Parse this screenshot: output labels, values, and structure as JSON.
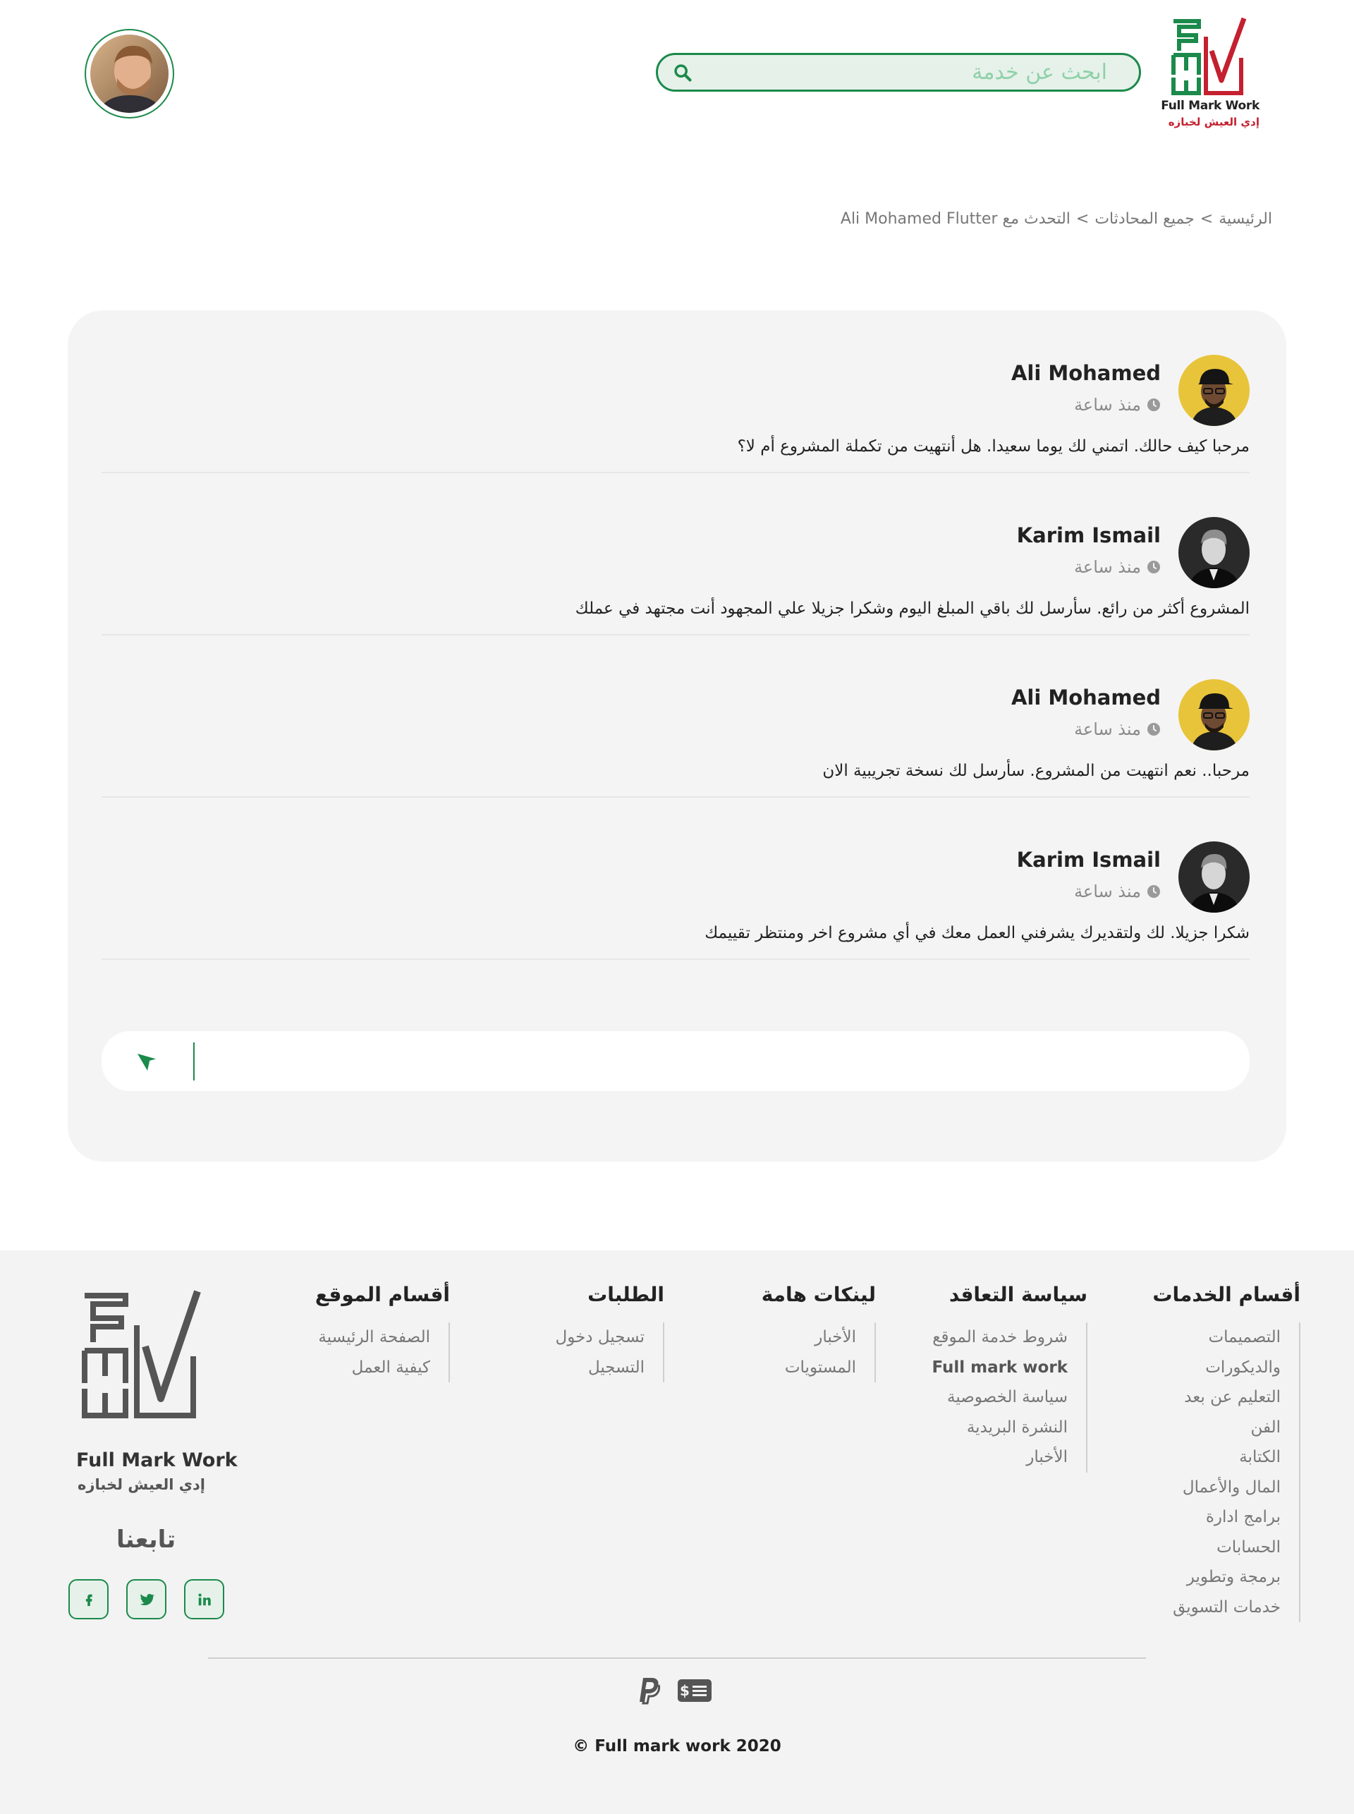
{
  "header": {
    "logo_text": "Full Mark Work",
    "logo_tagline": "إدي العيش لخبازه",
    "search_placeholder": "ابحث عن خدمة",
    "brand_green": "#1b8a4b",
    "brand_red": "#c4202f"
  },
  "breadcrumb": {
    "home": "الرئيسية",
    "sep1": ">",
    "all_chats": "جميع المحادثات",
    "sep2": ">",
    "current": "التحدث مع Ali Mohamed Flutter"
  },
  "messages": [
    {
      "name": "Ali Mohamed",
      "time": "منذ ساعة",
      "text": "مرحبا كيف حالك. اتمني لك يوما سعيدا. هل أنتهيت من تكملة المشروع أم لا؟",
      "avatar": "yellow-avatar"
    },
    {
      "name": "Karim Ismail",
      "time": "منذ ساعة",
      "text": "المشروع أكثر من رائع. سأرسل لك باقي المبلغ اليوم وشكرا جزيلا علي المجهود أنت مجتهد في عملك",
      "avatar": "bw-avatar"
    },
    {
      "name": "Ali Mohamed",
      "time": "منذ ساعة",
      "text": "مرحبا.. نعم انتهيت من المشروع. سأرسل لك نسخة تجريبية الان",
      "avatar": "yellow-avatar"
    },
    {
      "name": "Karim Ismail",
      "time": "منذ ساعة",
      "text": "شكرا جزيلا. لك ولتقديرك يشرفني العمل معك في أي مشروع اخر ومنتظر تقييمك",
      "avatar": "bw-avatar"
    }
  ],
  "composer": {
    "value": "",
    "send_icon": "send-icon"
  },
  "footer": {
    "columns": [
      {
        "title": "أقسام الخدمات",
        "items": [
          "التصميمات",
          "والديكورات",
          "التعليم عن بعد",
          "الفن",
          "الكتابة",
          "المال والأعمال",
          "برامج ادارة",
          "الحسابات",
          "برمجة وتطوير",
          "خدمات التسويق"
        ]
      },
      {
        "title": "سياسة التعاقد",
        "items": [
          "شروط خدمة الموقع",
          "Full mark work",
          "سياسة الخصوصية",
          "النشرة البريدية",
          "الأخبار"
        ]
      },
      {
        "title": "لينكات هامة",
        "items": [
          "الأخبار",
          "المستويات"
        ]
      },
      {
        "title": "الطلبات",
        "items": [
          "تسجيل دخول",
          "التسجيل"
        ]
      },
      {
        "title": "أقسام الموقع",
        "items": [
          "الصفحة الرئيسية",
          "كيفية العمل"
        ]
      }
    ],
    "logo_text": "Full Mark Work",
    "logo_tagline": "إدي العيش لخبازه",
    "follow_us": "تابعنا",
    "socials": [
      "facebook-icon",
      "twitter-icon",
      "linkedin-icon"
    ],
    "payments": [
      "paypal-icon",
      "cash-icon"
    ],
    "copyright": "© Full mark work 2020"
  }
}
